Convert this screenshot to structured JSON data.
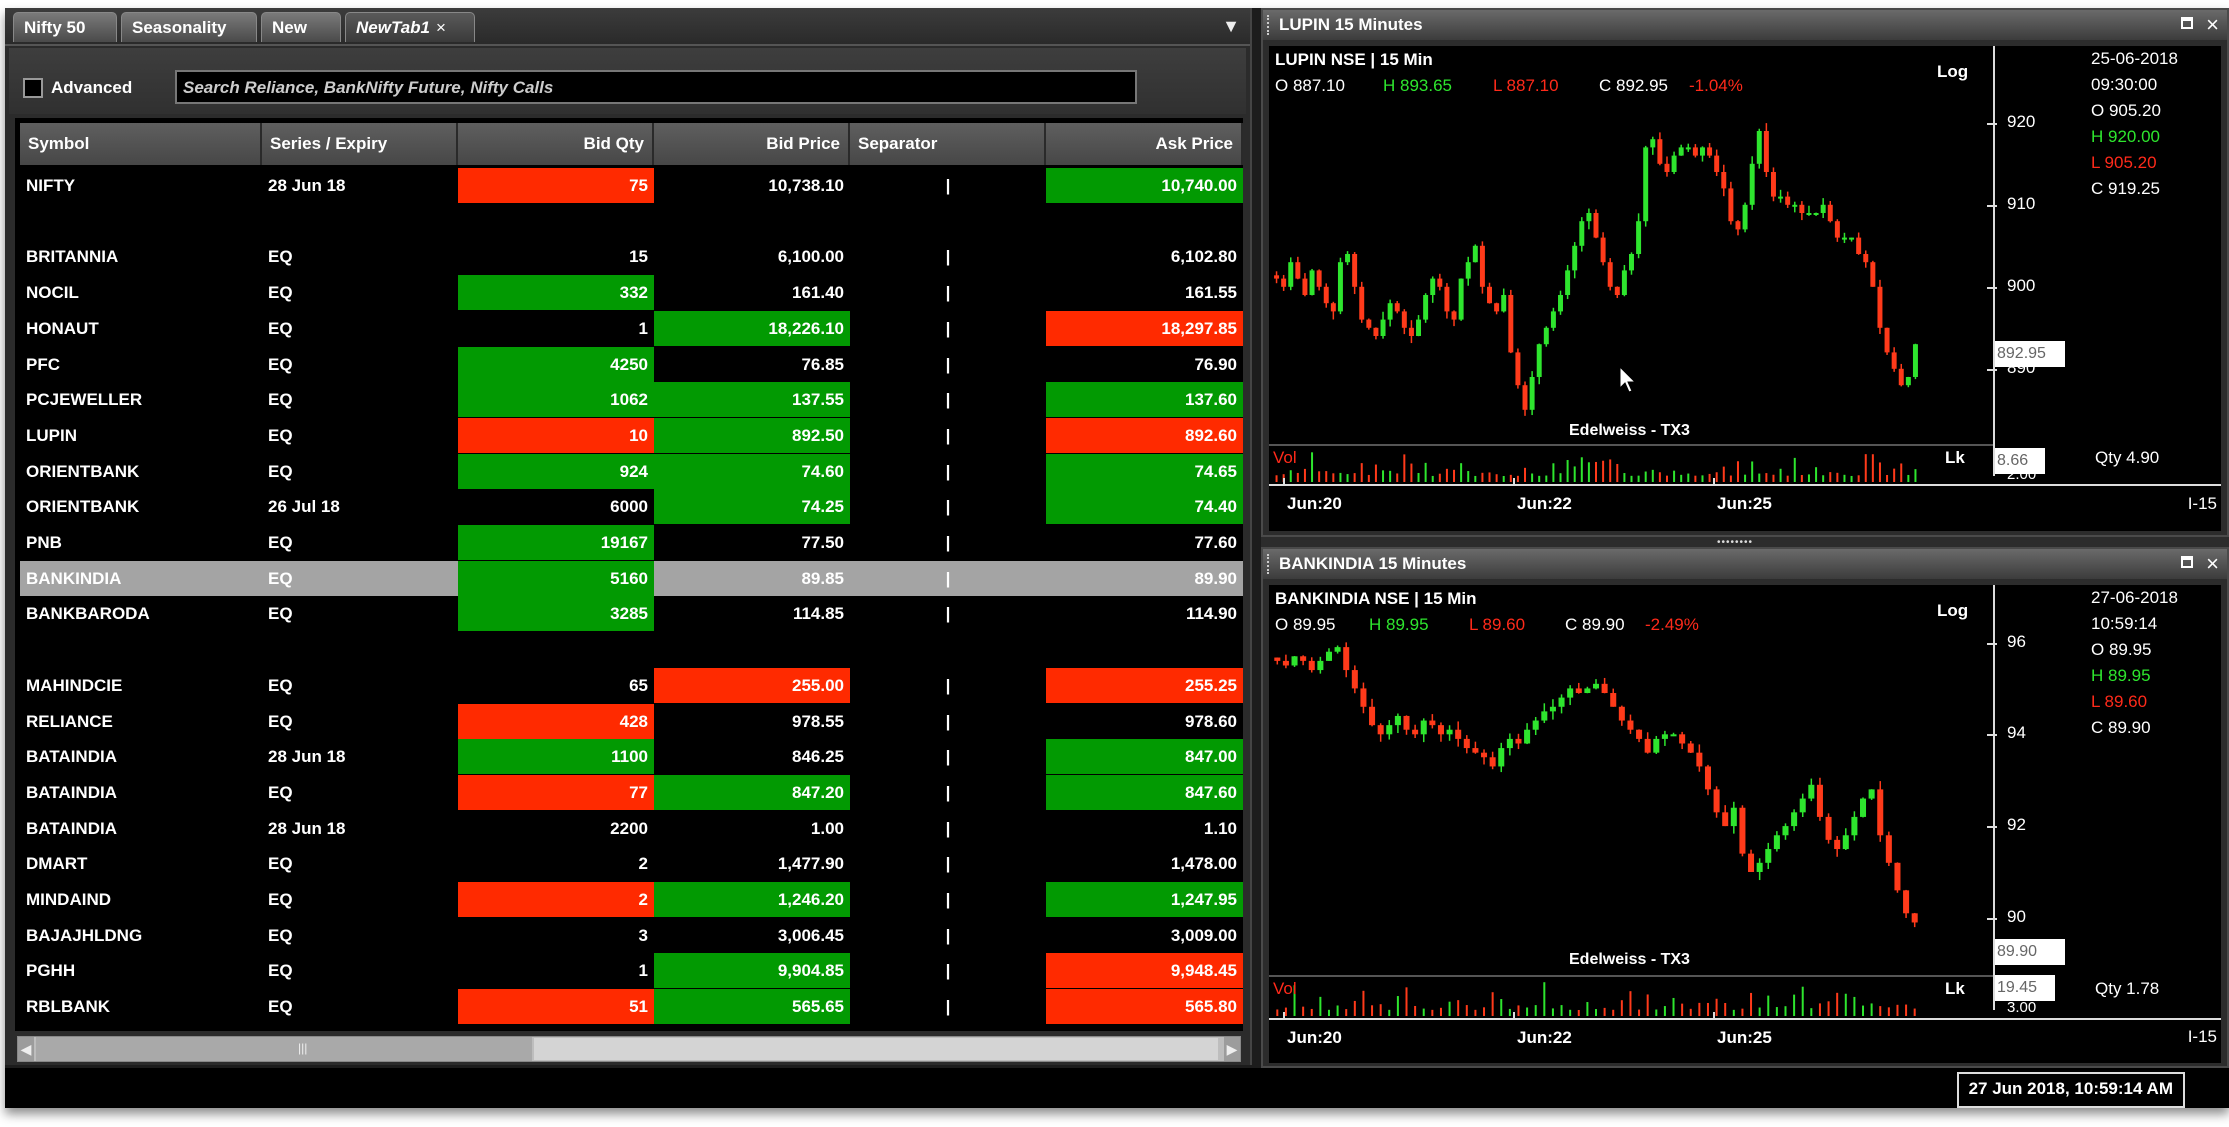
{
  "tabs": [
    {
      "label": "Nifty 50",
      "active": false
    },
    {
      "label": "Seasonality",
      "active": false
    },
    {
      "label": "New",
      "active": false
    },
    {
      "label": "NewTab1",
      "active": true
    }
  ],
  "tab_close_glyph": "×",
  "tab_menu_icon": "▼",
  "toolbar": {
    "advanced_label": "Advanced",
    "advanced_checked": false,
    "search_placeholder": "Search Reliance, BankNifty Future, Nifty Calls"
  },
  "colors": {
    "red": "#ff2a00",
    "green": "#029a02",
    "selected_row": "#a4a4a4"
  },
  "grid": {
    "columns": [
      "Symbol",
      "Series / Expiry",
      "Bid Qty",
      "Bid Price",
      "Separator",
      "Ask Price"
    ],
    "rows": [
      {
        "symbol": "NIFTY",
        "series": "28 Jun 18",
        "bid_qty": "75",
        "bid_price": "10,738.10",
        "sep": "|",
        "ask_price": "10,740.00",
        "qty_bg": "red",
        "bid_bg": "",
        "ask_bg": "green"
      },
      {
        "blank": true
      },
      {
        "symbol": "BRITANNIA",
        "series": "EQ",
        "bid_qty": "15",
        "bid_price": "6,100.00",
        "sep": "|",
        "ask_price": "6,102.80",
        "qty_bg": "",
        "bid_bg": "",
        "ask_bg": ""
      },
      {
        "symbol": "NOCIL",
        "series": "EQ",
        "bid_qty": "332",
        "bid_price": "161.40",
        "sep": "|",
        "ask_price": "161.55",
        "qty_bg": "green",
        "bid_bg": "",
        "ask_bg": ""
      },
      {
        "symbol": "HONAUT",
        "series": "EQ",
        "bid_qty": "1",
        "bid_price": "18,226.10",
        "sep": "|",
        "ask_price": "18,297.85",
        "qty_bg": "",
        "bid_bg": "green",
        "ask_bg": "red"
      },
      {
        "symbol": "PFC",
        "series": "EQ",
        "bid_qty": "4250",
        "bid_price": "76.85",
        "sep": "|",
        "ask_price": "76.90",
        "qty_bg": "green",
        "bid_bg": "",
        "ask_bg": ""
      },
      {
        "symbol": "PCJEWELLER",
        "series": "EQ",
        "bid_qty": "1062",
        "bid_price": "137.55",
        "sep": "|",
        "ask_price": "137.60",
        "qty_bg": "green",
        "bid_bg": "green",
        "ask_bg": "green"
      },
      {
        "symbol": "LUPIN",
        "series": "EQ",
        "bid_qty": "10",
        "bid_price": "892.50",
        "sep": "|",
        "ask_price": "892.60",
        "qty_bg": "red",
        "bid_bg": "green",
        "ask_bg": "red"
      },
      {
        "symbol": "ORIENTBANK",
        "series": "EQ",
        "bid_qty": "924",
        "bid_price": "74.60",
        "sep": "|",
        "ask_price": "74.65",
        "qty_bg": "green",
        "bid_bg": "green",
        "ask_bg": "green"
      },
      {
        "symbol": "ORIENTBANK",
        "series": "26 Jul 18",
        "bid_qty": "6000",
        "bid_price": "74.25",
        "sep": "|",
        "ask_price": "74.40",
        "qty_bg": "",
        "bid_bg": "green",
        "ask_bg": "green"
      },
      {
        "symbol": "PNB",
        "series": "EQ",
        "bid_qty": "19167",
        "bid_price": "77.50",
        "sep": "|",
        "ask_price": "77.60",
        "qty_bg": "green",
        "bid_bg": "",
        "ask_bg": ""
      },
      {
        "symbol": "BANKINDIA",
        "series": "EQ",
        "bid_qty": "5160",
        "bid_price": "89.85",
        "sep": "|",
        "ask_price": "89.90",
        "qty_bg": "green",
        "bid_bg": "",
        "ask_bg": "",
        "selected": true
      },
      {
        "symbol": "BANKBARODA",
        "series": "EQ",
        "bid_qty": "3285",
        "bid_price": "114.85",
        "sep": "|",
        "ask_price": "114.90",
        "qty_bg": "green",
        "bid_bg": "",
        "ask_bg": ""
      },
      {
        "blank": true
      },
      {
        "symbol": "MAHINDCIE",
        "series": "EQ",
        "bid_qty": "65",
        "bid_price": "255.00",
        "sep": "|",
        "ask_price": "255.25",
        "qty_bg": "",
        "bid_bg": "red",
        "ask_bg": "red"
      },
      {
        "symbol": "RELIANCE",
        "series": "EQ",
        "bid_qty": "428",
        "bid_price": "978.55",
        "sep": "|",
        "ask_price": "978.60",
        "qty_bg": "red",
        "bid_bg": "",
        "ask_bg": ""
      },
      {
        "symbol": "BATAINDIA",
        "series": "28 Jun 18",
        "bid_qty": "1100",
        "bid_price": "846.25",
        "sep": "|",
        "ask_price": "847.00",
        "qty_bg": "green",
        "bid_bg": "",
        "ask_bg": "green"
      },
      {
        "symbol": "BATAINDIA",
        "series": "EQ",
        "bid_qty": "77",
        "bid_price": "847.20",
        "sep": "|",
        "ask_price": "847.60",
        "qty_bg": "red",
        "bid_bg": "green",
        "ask_bg": "green"
      },
      {
        "symbol": "BATAINDIA",
        "series": "28 Jun 18",
        "bid_qty": "2200",
        "bid_price": "1.00",
        "sep": "|",
        "ask_price": "1.10",
        "qty_bg": "",
        "bid_bg": "",
        "ask_bg": ""
      },
      {
        "symbol": "DMART",
        "series": "EQ",
        "bid_qty": "2",
        "bid_price": "1,477.90",
        "sep": "|",
        "ask_price": "1,478.00",
        "qty_bg": "",
        "bid_bg": "",
        "ask_bg": ""
      },
      {
        "symbol": "MINDAIND",
        "series": "EQ",
        "bid_qty": "2",
        "bid_price": "1,246.20",
        "sep": "|",
        "ask_price": "1,247.95",
        "qty_bg": "red",
        "bid_bg": "green",
        "ask_bg": "green"
      },
      {
        "symbol": "BAJAJHLDNG",
        "series": "EQ",
        "bid_qty": "3",
        "bid_price": "3,006.45",
        "sep": "|",
        "ask_price": "3,009.00",
        "qty_bg": "",
        "bid_bg": "",
        "ask_bg": ""
      },
      {
        "symbol": "PGHH",
        "series": "EQ",
        "bid_qty": "1",
        "bid_price": "9,904.85",
        "sep": "|",
        "ask_price": "9,948.45",
        "qty_bg": "",
        "bid_bg": "green",
        "ask_bg": "red"
      },
      {
        "symbol": "RBLBANK",
        "series": "EQ",
        "bid_qty": "51",
        "bid_price": "565.65",
        "sep": "|",
        "ask_price": "565.80",
        "qty_bg": "red",
        "bid_bg": "green",
        "ask_bg": "red"
      }
    ],
    "hscroll_grip": "|||",
    "hscroll_left": "◀",
    "hscroll_right": "▶"
  },
  "status_bar": {
    "clock": "27 Jun 2018, 10:59:14 AM"
  },
  "chart_data": [
    {
      "type": "candlestick",
      "panel_title": "LUPIN  15 Minutes",
      "title": "LUPIN NSE | 15 Min",
      "header_ohlc": {
        "O": "O 887.10",
        "H": "H 893.65",
        "L": "L 887.10",
        "C": "C 892.95",
        "change": "-1.04%"
      },
      "scale_label": "Log",
      "y_ticks": [
        920,
        910,
        900,
        890
      ],
      "ylim": [
        884,
        924
      ],
      "x_ticks": [
        "Jun:20",
        "Jun:22",
        "Jun:25"
      ],
      "interval_label": "I-15",
      "watermark": "Edelweiss - TX3",
      "last_price_marker": "892.95",
      "crosshair_info": {
        "date": "25-06-2018",
        "time": "09:30:00",
        "O": "O  905.20",
        "H": "H  920.00",
        "L": "L  905.20",
        "C": "C  919.25"
      },
      "volume": {
        "label": "Vol",
        "lk_label": "Lk",
        "marker": "8.66",
        "tick": "2.00",
        "qty": "Qty 4.90"
      },
      "close_series": [
        901,
        900,
        903,
        901,
        899,
        902,
        900,
        898,
        897,
        903,
        904,
        900,
        896,
        895,
        894,
        896,
        898,
        897,
        895,
        894,
        896,
        899,
        901,
        900,
        897,
        896,
        901,
        903,
        905,
        900,
        898,
        897,
        899,
        892,
        888,
        885,
        889,
        893,
        895,
        897,
        899,
        902,
        905,
        908,
        909,
        906,
        903,
        900,
        899,
        902,
        904,
        908,
        917,
        918,
        915,
        914,
        916,
        917,
        917,
        916,
        917,
        916,
        914,
        912,
        908,
        907,
        910,
        915,
        919,
        914,
        911,
        911,
        910,
        910,
        909,
        909,
        909,
        910,
        908,
        906,
        906,
        906,
        904,
        903,
        900,
        895,
        892,
        890,
        888,
        889,
        893
      ]
    },
    {
      "type": "candlestick",
      "panel_title": "BANKINDIA  15 Minutes",
      "title": "BANKINDIA NSE | 15 Min",
      "header_ohlc": {
        "O": "O 89.95",
        "H": "H 89.95",
        "L": "L 89.60",
        "C": "C 89.90",
        "change": "-2.49%"
      },
      "scale_label": "Log",
      "y_ticks": [
        96,
        94,
        92,
        90
      ],
      "ylim": [
        89.3,
        96.6
      ],
      "x_ticks": [
        "Jun:20",
        "Jun:22",
        "Jun:25"
      ],
      "interval_label": "I-15",
      "watermark": "Edelweiss - TX3",
      "last_price_marker": "89.90",
      "crosshair_info": {
        "date": "27-06-2018",
        "time": "10:59:14",
        "O": "O  89.95",
        "H": "H  89.95",
        "L": "L  89.60",
        "C": "C  89.90"
      },
      "volume": {
        "label": "Vol",
        "lk_label": "Lk",
        "marker": "19.45",
        "tick": "3.00",
        "qty": "Qty 1.78"
      },
      "close_series": [
        95.6,
        95.5,
        95.7,
        95.6,
        95.4,
        95.6,
        95.8,
        95.9,
        95.4,
        95.0,
        94.6,
        94.2,
        94.0,
        94.2,
        94.4,
        94.1,
        94.0,
        94.3,
        94.2,
        94.0,
        94.1,
        93.9,
        93.7,
        93.6,
        93.5,
        93.3,
        93.7,
        93.9,
        93.8,
        94.1,
        94.3,
        94.5,
        94.6,
        94.8,
        95.0,
        94.9,
        95.0,
        95.1,
        94.9,
        94.6,
        94.3,
        94.1,
        93.9,
        93.6,
        93.9,
        94.0,
        94.0,
        93.8,
        93.6,
        93.3,
        92.8,
        92.3,
        92.0,
        92.4,
        91.4,
        91.0,
        91.2,
        91.5,
        91.8,
        92.0,
        92.3,
        92.6,
        92.9,
        92.2,
        91.7,
        91.5,
        91.8,
        92.2,
        92.6,
        92.8,
        91.8,
        91.2,
        90.6,
        90.1,
        89.9
      ]
    }
  ]
}
